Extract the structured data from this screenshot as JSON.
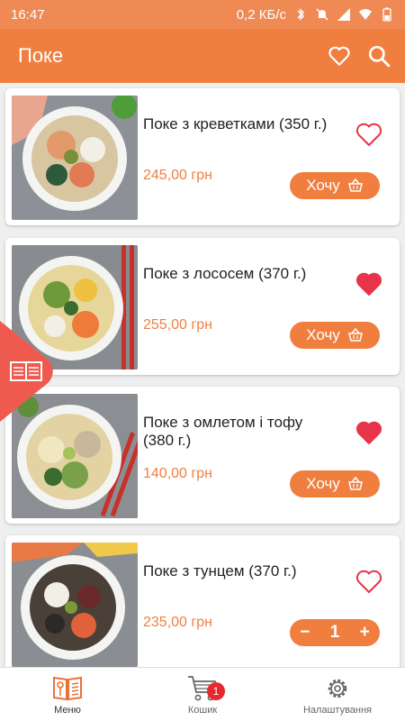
{
  "status_bar": {
    "time": "16:47",
    "speed": "0,2 КБ/с"
  },
  "app_bar": {
    "title": "Поке"
  },
  "products": [
    {
      "name": "Поке з креветками (350 г.)",
      "price": "245,00 грн",
      "favorite": false,
      "action": "Хочу"
    },
    {
      "name": "Поке з лососем (370 г.)",
      "price": "255,00 грн",
      "favorite": true,
      "action": "Хочу"
    },
    {
      "name": "Поке з омлетом і тофу (380 г.)",
      "price": "140,00 грн",
      "favorite": true,
      "action": "Хочу"
    },
    {
      "name": "Поке з тунцем (370 г.)",
      "price": "235,00 грн",
      "favorite": false,
      "quantity": "1",
      "minus": "−",
      "plus": "+"
    }
  ],
  "bottom_nav": {
    "menu": "Меню",
    "cart": "Кошик",
    "cart_badge": "1",
    "settings": "Налаштування"
  },
  "colors": {
    "accent": "#f07f3f",
    "favorite": "#e8344a",
    "badge": "#e8282b"
  }
}
